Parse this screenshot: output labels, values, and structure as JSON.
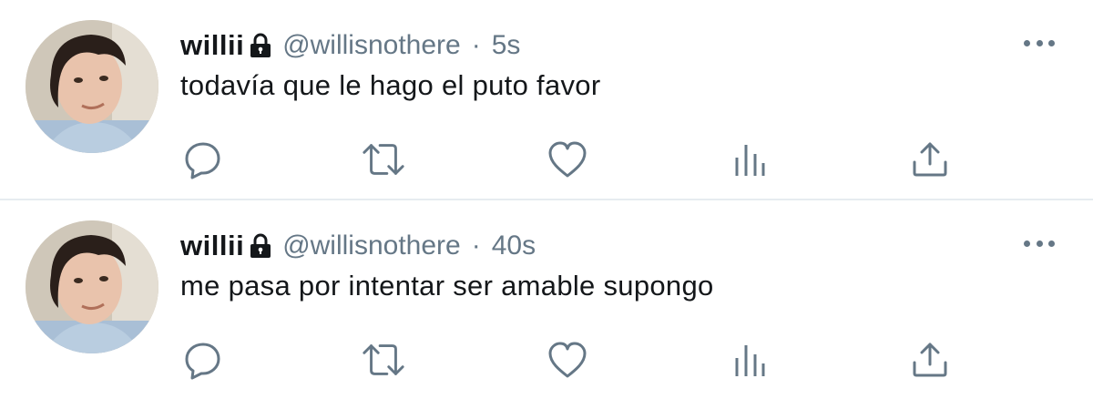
{
  "tweets": [
    {
      "display_name": "willii",
      "handle": "@willisnothere",
      "separator": "·",
      "time": "5s",
      "text": "todavía que le hago el puto favor"
    },
    {
      "display_name": "willii",
      "handle": "@willisnothere",
      "separator": "·",
      "time": "40s",
      "text": "me pasa por intentar ser amable supongo"
    }
  ],
  "icons": {
    "lock": "lock-icon",
    "more": "more-options-icon",
    "reply": "reply-icon",
    "retweet": "retweet-icon",
    "like": "heart-icon",
    "stats": "stats-icon",
    "share": "share-icon"
  },
  "colors": {
    "text": "#14171a",
    "secondary": "#657786",
    "divider": "#e6ecf0"
  }
}
